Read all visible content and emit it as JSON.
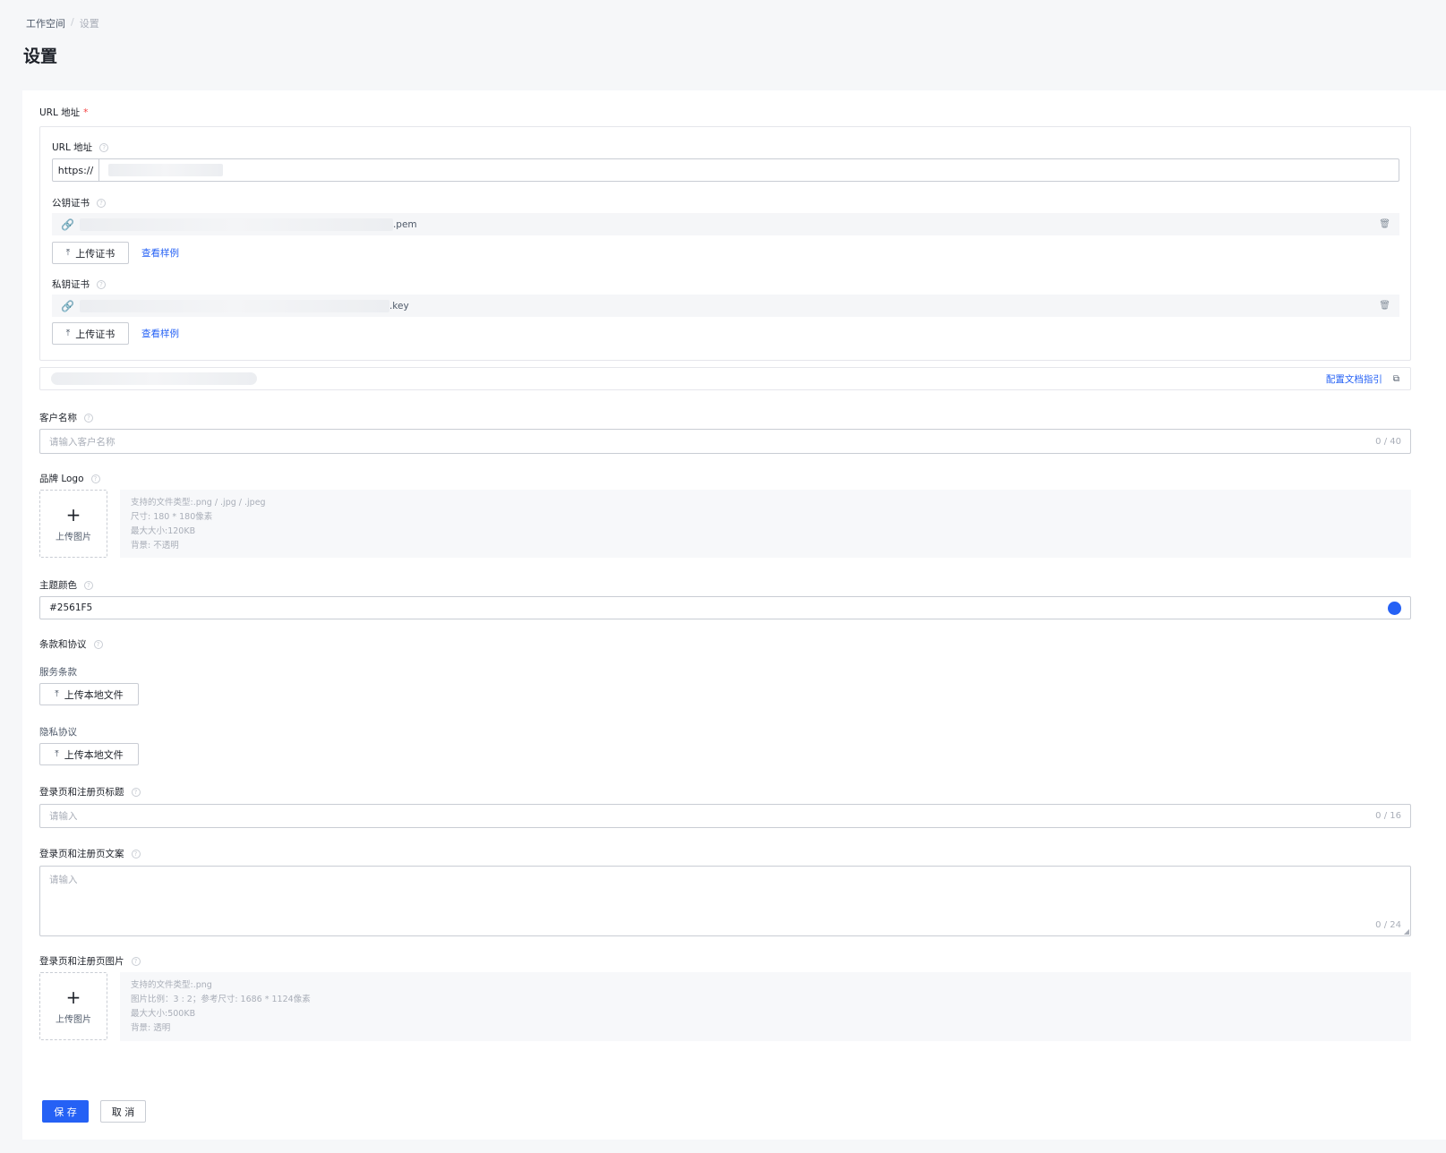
{
  "breadcrumb": {
    "root": "工作空间",
    "separator": "/",
    "current": "设置"
  },
  "page_title": "设置",
  "url_section": {
    "label": "URL 地址",
    "required_mark": "*",
    "url_label": "URL 地址",
    "url_prefix": "https://",
    "public_cert": {
      "label": "公钥证书",
      "file_suffix": ".pem",
      "upload_label": "上传证书",
      "example_link": "查看样例"
    },
    "private_cert": {
      "label": "私钥证书",
      "file_suffix": ".key",
      "upload_label": "上传证书",
      "example_link": "查看样例"
    },
    "guide_link": "配置文档指引"
  },
  "customer_name": {
    "label": "客户名称",
    "placeholder": "请输入客户名称",
    "counter": "0 / 40"
  },
  "brand_logo": {
    "label": "品牌 Logo",
    "upload_text": "上传图片",
    "hints": [
      "支持的文件类型:.png / .jpg / .jpeg",
      "尺寸: 180 * 180像素",
      "最大大小:120KB",
      "背景: 不透明"
    ]
  },
  "theme_color": {
    "label": "主题颜色",
    "value": "#2561F5",
    "swatch": "#2561f5"
  },
  "terms": {
    "label": "条款和协议",
    "service_label": "服务条款",
    "privacy_label": "隐私协议",
    "upload_label": "上传本地文件"
  },
  "login_title": {
    "label": "登录页和注册页标题",
    "placeholder": "请输入",
    "counter": "0 / 16"
  },
  "login_copy": {
    "label": "登录页和注册页文案",
    "placeholder": "请输入",
    "counter": "0 / 24"
  },
  "login_image": {
    "label": "登录页和注册页图片",
    "upload_text": "上传图片",
    "hints": [
      "支持的文件类型:.png",
      "图片比例：3 : 2；参考尺寸: 1686 * 1124像素",
      "最大大小:500KB",
      "背景: 透明"
    ]
  },
  "actions": {
    "save": "保 存",
    "cancel": "取 消"
  }
}
